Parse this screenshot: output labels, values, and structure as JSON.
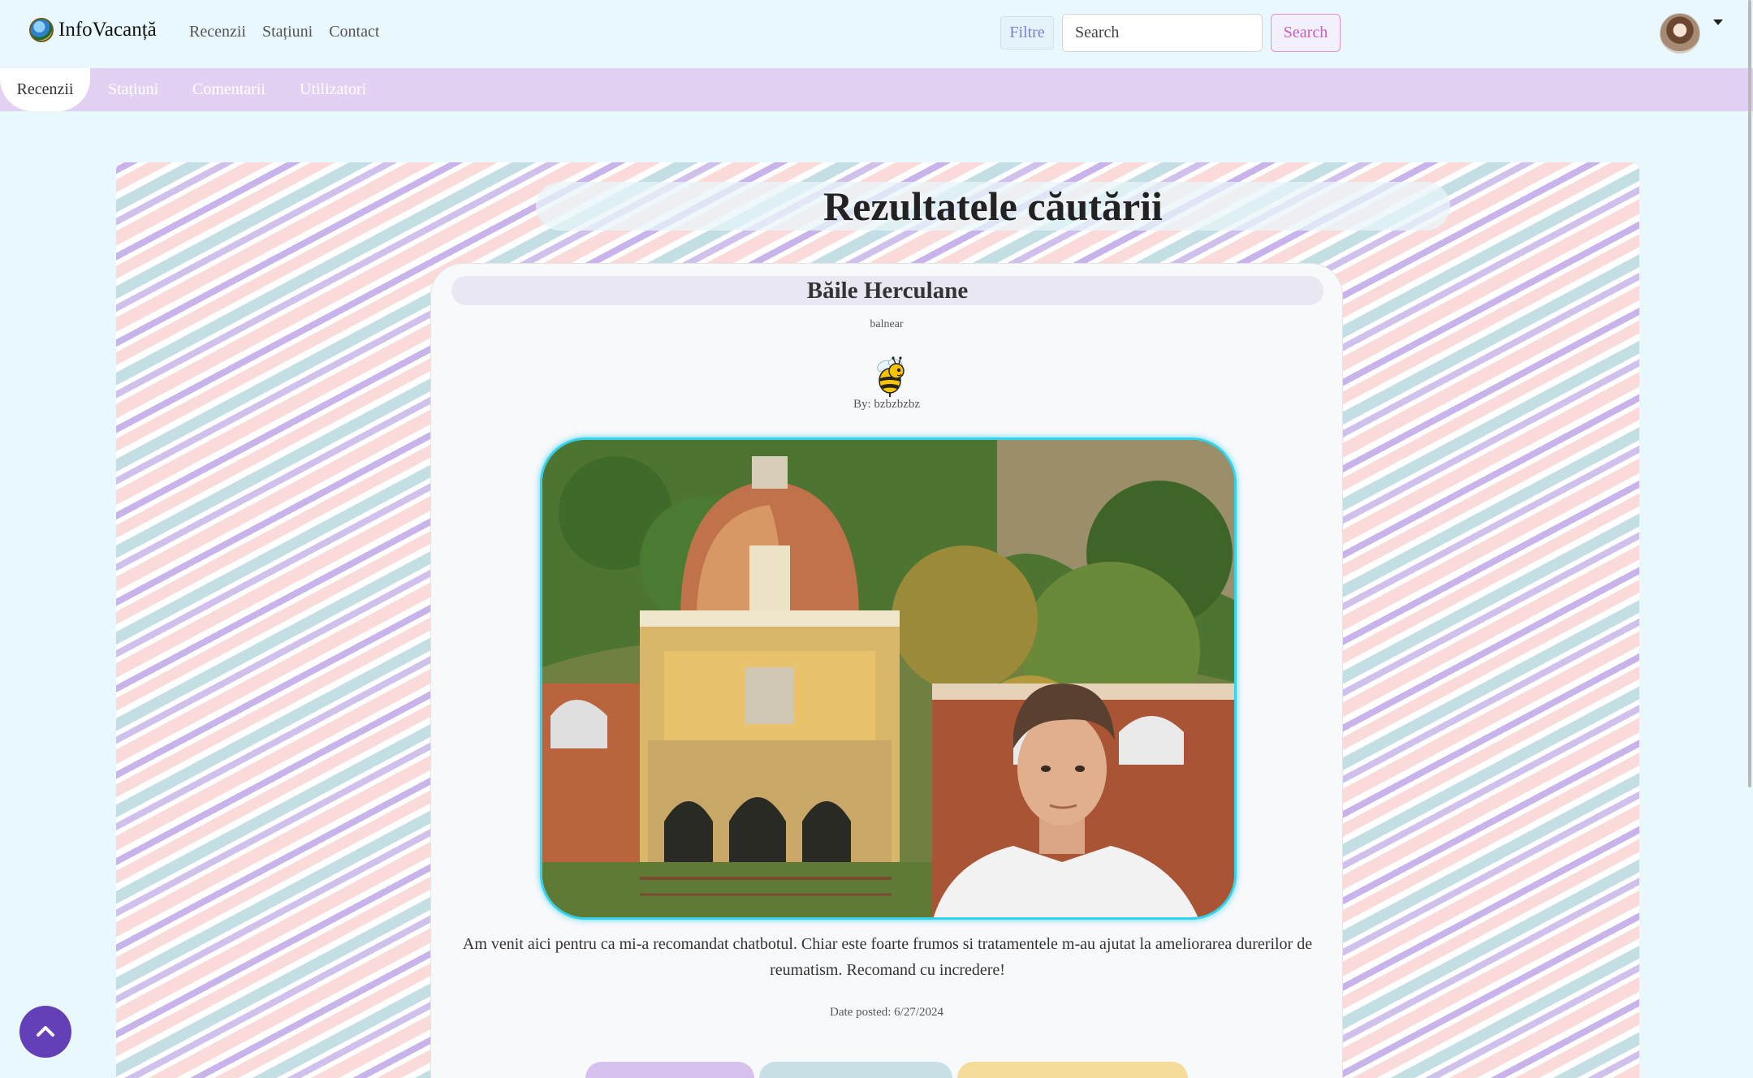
{
  "brand": {
    "name": "InfoVacanță",
    "icon": "globe-logo-icon"
  },
  "nav": {
    "links": [
      "Recenzii",
      "Stațiuni",
      "Contact"
    ]
  },
  "search": {
    "filter_label": "Filtre",
    "placeholder": "Search",
    "button_label": "Search"
  },
  "user": {
    "avatar": "user-avatar",
    "menu_icon": "caret-down-icon"
  },
  "subnav": {
    "tabs": [
      "Recenzii",
      "Stațiuni",
      "Comentarii",
      "Utilizatori"
    ],
    "active": "Recenzii"
  },
  "main": {
    "title": "Rezultatele căutării",
    "review": {
      "location": "Băile Herculane",
      "category": "balnear",
      "author_icon": "bee-icon",
      "author": "By: bzbzbzbz",
      "text": "Am venit aici pentru ca mi-a recomandat chatbotul. Chiar este foarte frumos si tratamentele m-au ajutat la ameliorarea durerilor de reumatism. Recomand cu incredere!",
      "date": "Date posted: 6/27/2024"
    }
  },
  "scroll_top_icon": "chevron-up-icon",
  "colors": {
    "page_bg": "#e9f8fc",
    "subnav_bg": "#e3d1f4",
    "photo_border": "#35d2ec",
    "scroll_button": "#6440b8",
    "search_accent": "#d05cc4",
    "pill_colors": [
      "#d7c2ef",
      "#c9dfe6",
      "#f6dc9a"
    ]
  }
}
